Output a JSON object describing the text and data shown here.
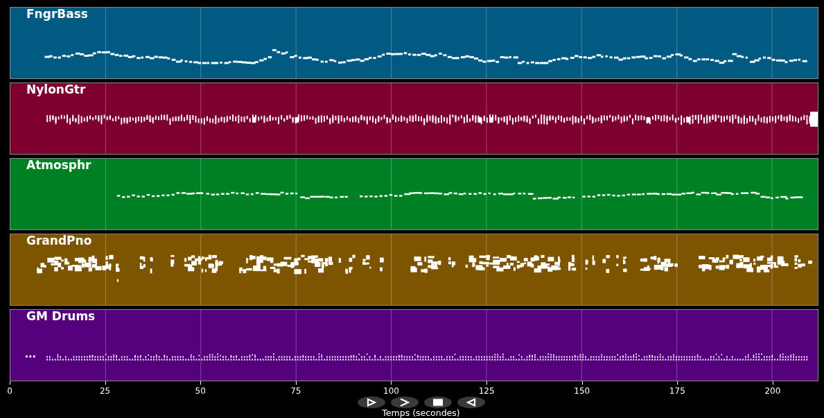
{
  "tracks": [
    {
      "name": "FngrBass",
      "kind": "bass",
      "color": "#005a82"
    },
    {
      "name": "NylonGtr",
      "kind": "guitar",
      "color": "#7d0030"
    },
    {
      "name": "Atmosphr",
      "kind": "pad",
      "color": "#008025"
    },
    {
      "name": "GrandPno",
      "kind": "piano",
      "color": "#7d5500"
    },
    {
      "name": "GM Drums",
      "kind": "drums",
      "color": "#55007d"
    }
  ],
  "x_axis": {
    "label": "Temps (secondes)",
    "ticks": [
      "0",
      "25",
      "50",
      "75",
      "100",
      "125",
      "150",
      "175",
      "200"
    ]
  },
  "controls": [
    {
      "kind": "play"
    },
    {
      "kind": "forward"
    },
    {
      "kind": "stop"
    },
    {
      "kind": "rewind"
    }
  ]
}
